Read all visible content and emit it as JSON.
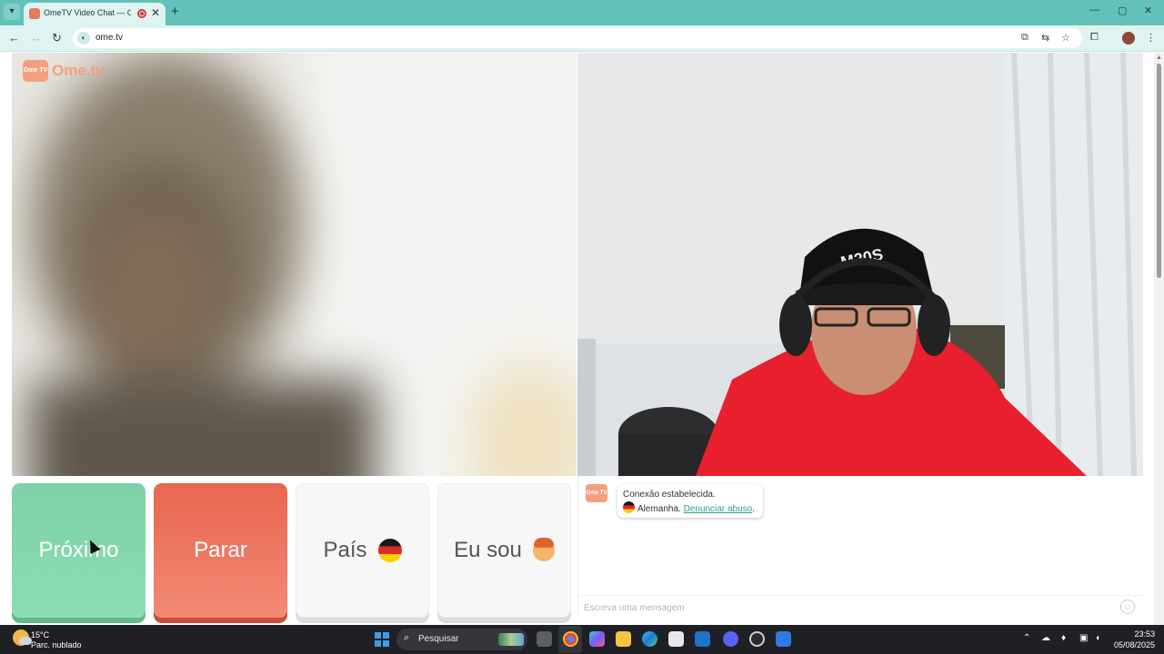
{
  "browser": {
    "tab_title": "OmeTV Video Chat — Ome",
    "tab_close": "✕",
    "new_tab": "+",
    "url": "ome.tv",
    "window_controls": {
      "minimize": "—",
      "maximize": "▢",
      "close": "✕"
    }
  },
  "page": {
    "logo_text": "Ome.tv",
    "logo_badge": "Ome TV",
    "buttons": {
      "next": "Próximo",
      "stop": "Parar",
      "country": "País",
      "i_am": "Eu sou"
    },
    "chat": {
      "status": "Conexão estabelecida.",
      "country": "Alemanha.",
      "report_link": "Denunciar abuso",
      "report_suffix": ".",
      "input_placeholder": "Escreva uma mensagem"
    }
  },
  "taskbar": {
    "temperature": "15°C",
    "weather": "Parc. nublado",
    "search_placeholder": "Pesquisar",
    "time": "23:53",
    "date": "05/08/2025"
  },
  "colors": {
    "next_button": "#7dd2a7",
    "stop_button": "#e86651",
    "brand": "#f2a07e",
    "link": "#2b9e8e",
    "chrome_tabbar": "#62c2ba"
  }
}
